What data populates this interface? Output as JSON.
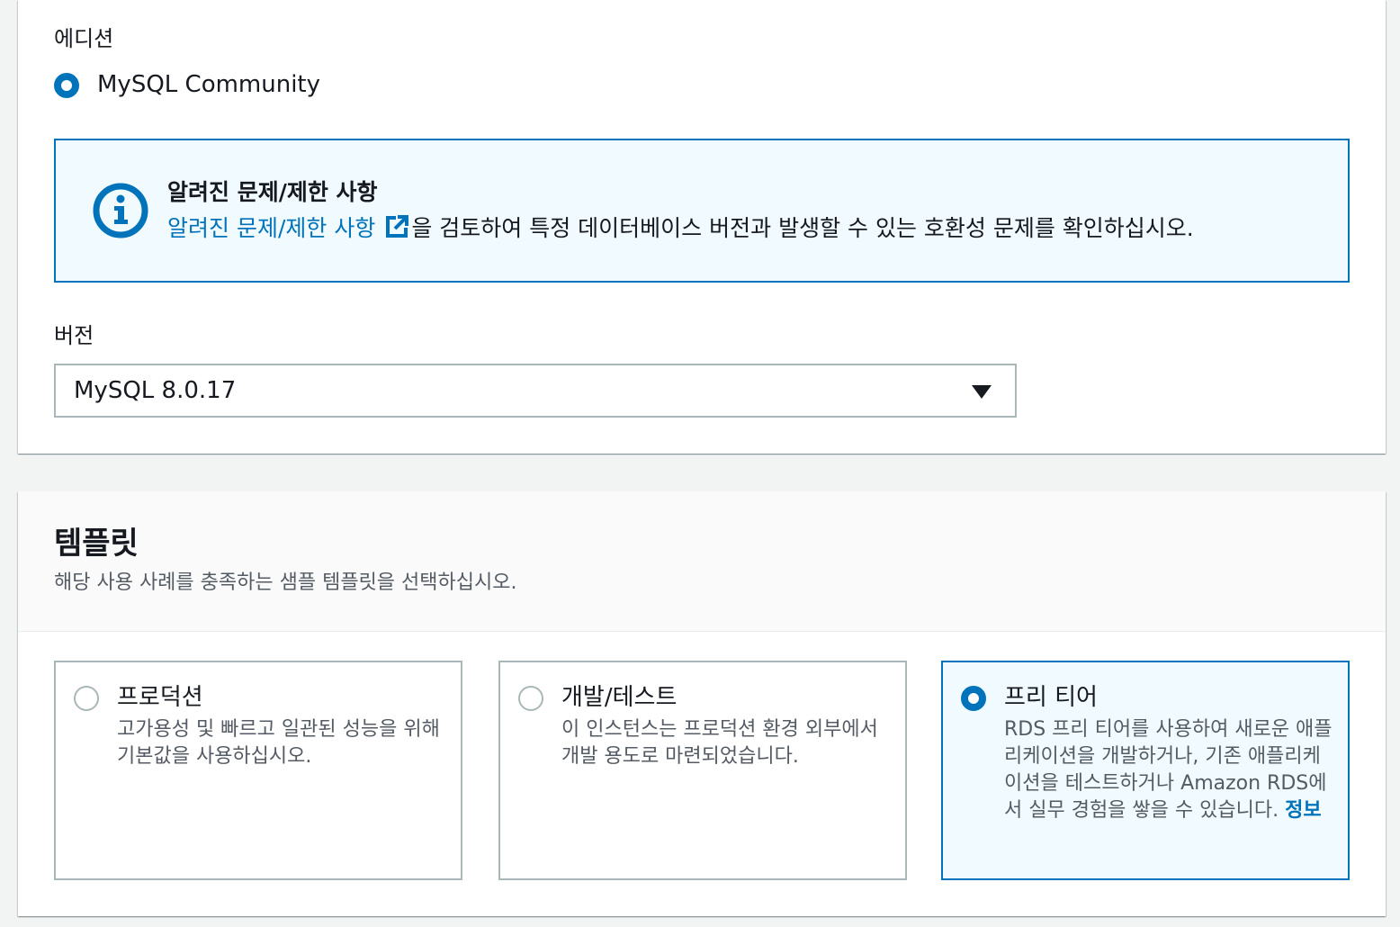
{
  "edition": {
    "label": "에디션",
    "option": "MySQL Community",
    "selected": true
  },
  "alert": {
    "icon": "info-circle-icon",
    "title": "알려진 문제/제한 사항",
    "link_text": "알려진 문제/제한 사항",
    "link_icon": "external-link-icon",
    "body_text": "을 검토하여 특정 데이터베이스 버전과 발생할 수 있는 호환성 문제를 확인하십시오."
  },
  "version": {
    "label": "버전",
    "selected_value": "MySQL 8.0.17"
  },
  "templates": {
    "title": "템플릿",
    "description": "해당 사용 사례를 충족하는 샘플 템플릿을 선택하십시오.",
    "options": [
      {
        "title": "프로덕션",
        "description": "고가용성 및 빠르고 일관된 성능을 위해 기본값을 사용하십시오.",
        "selected": false
      },
      {
        "title": "개발/테스트",
        "description": "이 인스턴스는 프로덕션 환경 외부에서 개발 용도로 마련되었습니다.",
        "selected": false
      },
      {
        "title": "프리 티어",
        "description": "RDS 프리 티어를 사용하여 새로운 애플리케이션을 개발하거나, 기존 애플리케이션을 테스트하거나 Amazon RDS에서 실무 경험을 쌓을 수 있습니다.",
        "info_link": "정보",
        "selected": true
      }
    ]
  },
  "colors": {
    "accent": "#0073bb",
    "alert_bg": "#f1faff",
    "border": "#aab7b8",
    "text": "#16191f",
    "muted_text": "#545b64"
  }
}
